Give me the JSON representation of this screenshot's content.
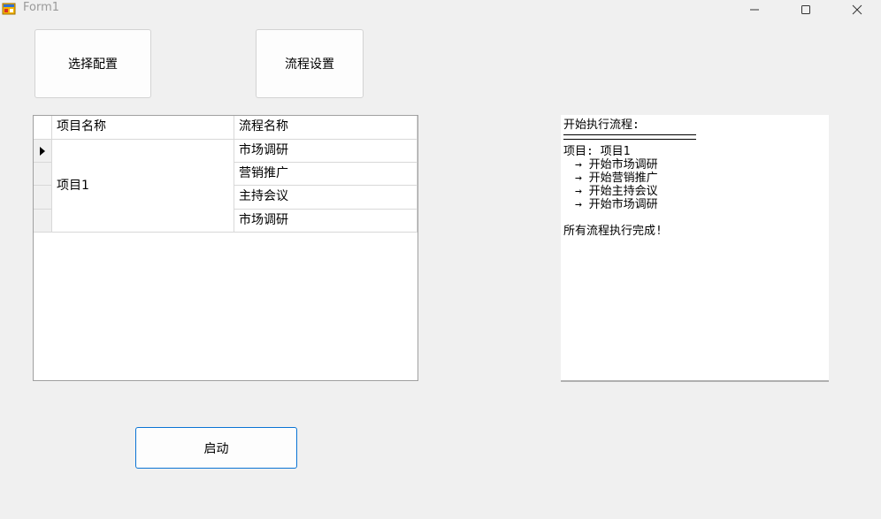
{
  "window": {
    "title": "Form1"
  },
  "buttons": {
    "select_config": "选择配置",
    "flow_settings": "流程设置",
    "start": "启动"
  },
  "grid": {
    "columns": [
      "项目名称",
      "流程名称"
    ],
    "project": "项目1",
    "flows": [
      "市场调研",
      "营销推广",
      "主持会议",
      "市场调研"
    ]
  },
  "log": {
    "header": "开始执行流程:",
    "project_line": "项目: 项目1",
    "steps": [
      "→ 开始市场调研",
      "→ 开始营销推广",
      "→ 开始主持会议",
      "→ 开始市场调研"
    ],
    "done": "所有流程执行完成!"
  }
}
